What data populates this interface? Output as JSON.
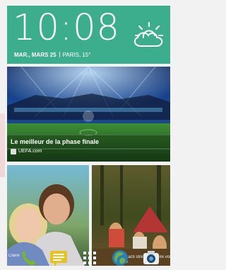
{
  "clock": {
    "time": "10:08",
    "date": "MAR., MARS 25",
    "city_temp": "PARIS, 15°"
  },
  "weather_icon": "partly-cloudy-icon",
  "news": {
    "headline": "Le meilleur de la phase finale",
    "source": "UEFA.com"
  },
  "notifications": {
    "left": "Claire",
    "right": "...ans acti stressé\nréduire vos stress"
  },
  "dock": {
    "apps": [
      "phone-icon",
      "messages-icon",
      "app-drawer-icon",
      "browser-icon",
      "camera-icon"
    ]
  },
  "colors": {
    "accent": "#3cae8d",
    "phone_green": "#79b828",
    "messages_yellow": "#e8c21e"
  }
}
